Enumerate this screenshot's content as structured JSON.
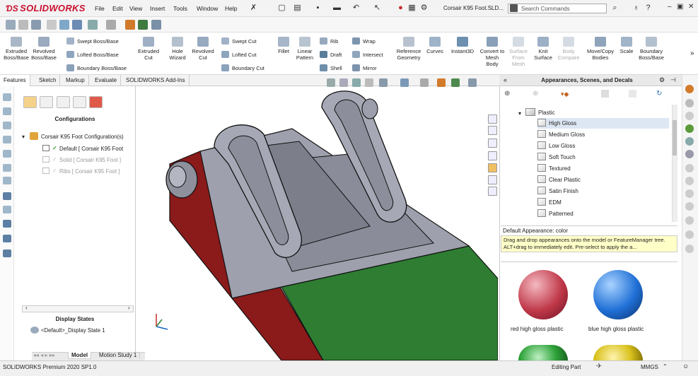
{
  "app": {
    "logo": "SOLIDWORKS",
    "menus": [
      "File",
      "Edit",
      "View",
      "Insert",
      "Tools",
      "Window",
      "Help"
    ],
    "document_title": "Corsair K95 Foot.SLD...",
    "search_placeholder": "Search Commands"
  },
  "command_manager": {
    "extruded_boss": "Extruded Boss/Base",
    "revolved_boss": "Revolved Boss/Base",
    "swept_boss": "Swept Boss/Base",
    "lofted_boss": "Lofted Boss/Base",
    "boundary_boss": "Boundary Boss/Base",
    "extruded_cut": "Extruded Cut",
    "hole_wizard": "Hole Wizard",
    "revolved_cut": "Revolved Cut",
    "swept_cut": "Swept Cut",
    "lofted_cut": "Lofted Cut",
    "boundary_cut": "Boundary Cut",
    "fillet": "Fillet",
    "linear_pattern": "Linear Pattern",
    "rib": "Rib",
    "draft": "Draft",
    "shell": "Shell",
    "wrap": "Wrap",
    "intersect": "Intersect",
    "mirror": "Mirror",
    "reference_geometry": "Reference Geometry",
    "curves": "Curves",
    "instant3d": "Instant3D",
    "convert_to_mesh": "Convert to Mesh Body",
    "surface_from_mesh": "Surface From Mesh",
    "knit_surface": "Knit Surface",
    "body_compare": "Body Compare",
    "move_copy_bodies": "Move/Copy Bodies",
    "scale": "Scale",
    "boundary_boss_right": "Boundary Boss/Base"
  },
  "tabs": [
    "Features",
    "Sketch",
    "Markup",
    "Evaluate",
    "SOLIDWORKS Add-Ins"
  ],
  "configuration_manager": {
    "title": "Configurations",
    "root": "Corsair K95 Foot Configuration(s)",
    "items": [
      {
        "label": "Default [ Corsair K95 Foot",
        "active": true
      },
      {
        "label": "Solid [ Corsair K95 Foot ]",
        "active": false
      },
      {
        "label": "Ribs [ Corsair K95 Foot ]",
        "active": false
      }
    ],
    "display_states_title": "Display States",
    "display_state": "<Default>_Display State 1"
  },
  "task_pane": {
    "title": "Appearances, Scenes, and Decals",
    "folder": "Plastic",
    "items": [
      "High Gloss",
      "Medium Gloss",
      "Low Gloss",
      "Soft Touch",
      "Textured",
      "Clear Plastic",
      "Satin Finish",
      "EDM",
      "Patterned"
    ],
    "selected_index": 0,
    "default_appearance_label": "Default Appearance: color",
    "tip": "Drag and drop appearances onto the model or FeatureManager tree.  ALT+drag to immediately edit.  Pre-select to apply the a...",
    "swatches": [
      {
        "label": "red high gloss plastic",
        "color": "#c0394a"
      },
      {
        "label": "blue high gloss plastic",
        "color": "#1f6fd6"
      },
      {
        "label": "",
        "color": "#2fa33a"
      },
      {
        "label": "",
        "color": "#d9c21e"
      }
    ]
  },
  "bottom_tabs": [
    "Model",
    "Motion Study 1"
  ],
  "status": {
    "left": "SOLIDWORKS Premium 2020 SP1.0",
    "editing": "Editing Part",
    "units": "MMGS"
  },
  "colors": {
    "model_gray": "#9ea0ad",
    "model_red": "#8b1a1a",
    "model_green": "#2e7d32",
    "brand_red": "#c8102e"
  }
}
